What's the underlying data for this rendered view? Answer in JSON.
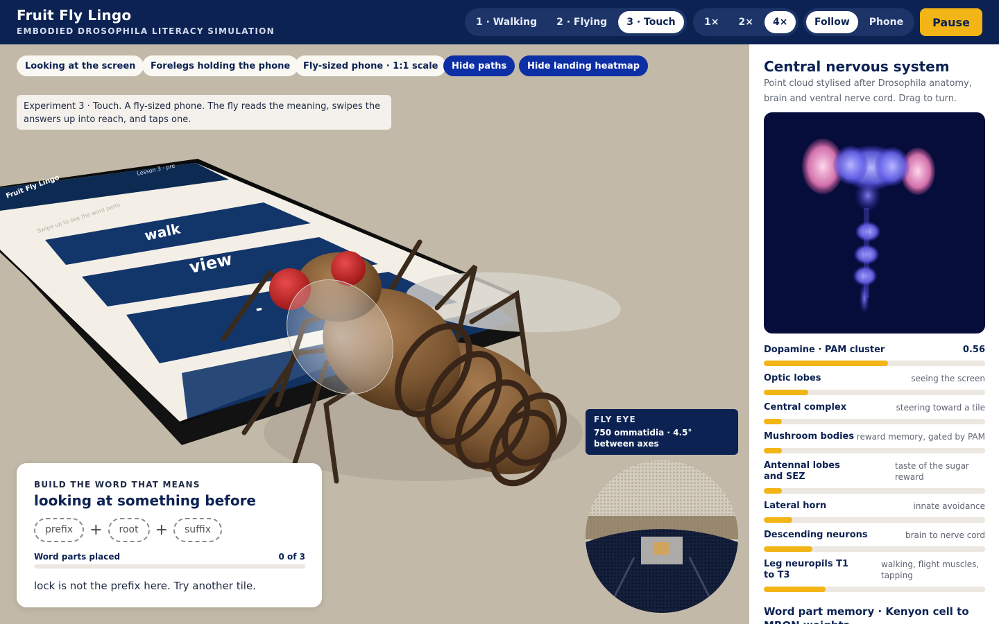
{
  "app": {
    "title": "Fruit Fly Lingo",
    "subtitle": "EMBODIED DROSOPHILA LITERACY SIMULATION"
  },
  "experiments": [
    {
      "label": "1 · Walking",
      "active": false
    },
    {
      "label": "2 · Flying",
      "active": false
    },
    {
      "label": "3 · Touch",
      "active": true
    }
  ],
  "speeds": [
    {
      "label": "1×",
      "active": false
    },
    {
      "label": "2×",
      "active": false
    },
    {
      "label": "4×",
      "active": true
    }
  ],
  "camera": [
    {
      "label": "Follow",
      "active": true
    },
    {
      "label": "Phone",
      "active": false
    }
  ],
  "pause_label": "Pause",
  "view_chips": [
    "Looking at the screen",
    "Forelegs holding the phone",
    "Fly-sized phone · 1:1 scale"
  ],
  "toggle_chips": [
    "Hide paths",
    "Hide landing heatmap"
  ],
  "caption": "Experiment 3 · Touch. A fly-sized phone. The fly reads the meaning, swipes the answers up into reach, and taps one.",
  "phone": {
    "app_title": "Fruit Fly Lingo",
    "lesson": "Lesson 3 · pre",
    "hint": "Swipe up to see the word parts",
    "tiles": [
      "walk",
      "view",
      "-"
    ]
  },
  "task": {
    "label": "BUILD THE WORD THAT MEANS",
    "title": "looking at something before",
    "parts": [
      "prefix",
      "root",
      "suffix"
    ],
    "plus": "+",
    "progress_label": "Word parts placed",
    "progress_value": "0 of 3",
    "progress_fraction": 0,
    "message": "lock is not the prefix here. Try another tile."
  },
  "fly_eye": {
    "title": "FLY EYE",
    "detail": "750 ommatidia · 4.5° between axes"
  },
  "sidebar": {
    "title": "Central nervous system",
    "subtitle": "Point cloud stylised after Drosophila anatomy, brain and ventral nerve cord. Drag to turn.",
    "dopamine": {
      "label": "Dopamine · PAM cluster",
      "value": "0.56",
      "fraction": 0.56
    },
    "regions": [
      {
        "name": "Optic lobes",
        "desc": "seeing the screen",
        "level": 0.2
      },
      {
        "name": "Central complex",
        "desc": "steering toward a tile",
        "level": 0.08
      },
      {
        "name": "Mushroom bodies",
        "desc": "reward memory, gated by PAM",
        "level": 0.08
      },
      {
        "name": "Antennal lobes and SEZ",
        "desc": "taste of the sugar reward",
        "level": 0.08
      },
      {
        "name": "Lateral horn",
        "desc": "innate avoidance",
        "level": 0.13
      },
      {
        "name": "Descending neurons",
        "desc": "brain to nerve cord",
        "level": 0.22
      },
      {
        "name": "Leg neuropils T1 to T3",
        "desc": "walking, flight muscles, tapping",
        "level": 0.28
      }
    ],
    "memory_title": "Word part memory · Kenyon cell to MBON weights"
  },
  "colors": {
    "navy": "#0c2253",
    "accent": "#f2b515",
    "toggle_blue": "#0d2fa6",
    "scene_bg": "#c2b9a8",
    "brain_bg": "#060d3b"
  }
}
